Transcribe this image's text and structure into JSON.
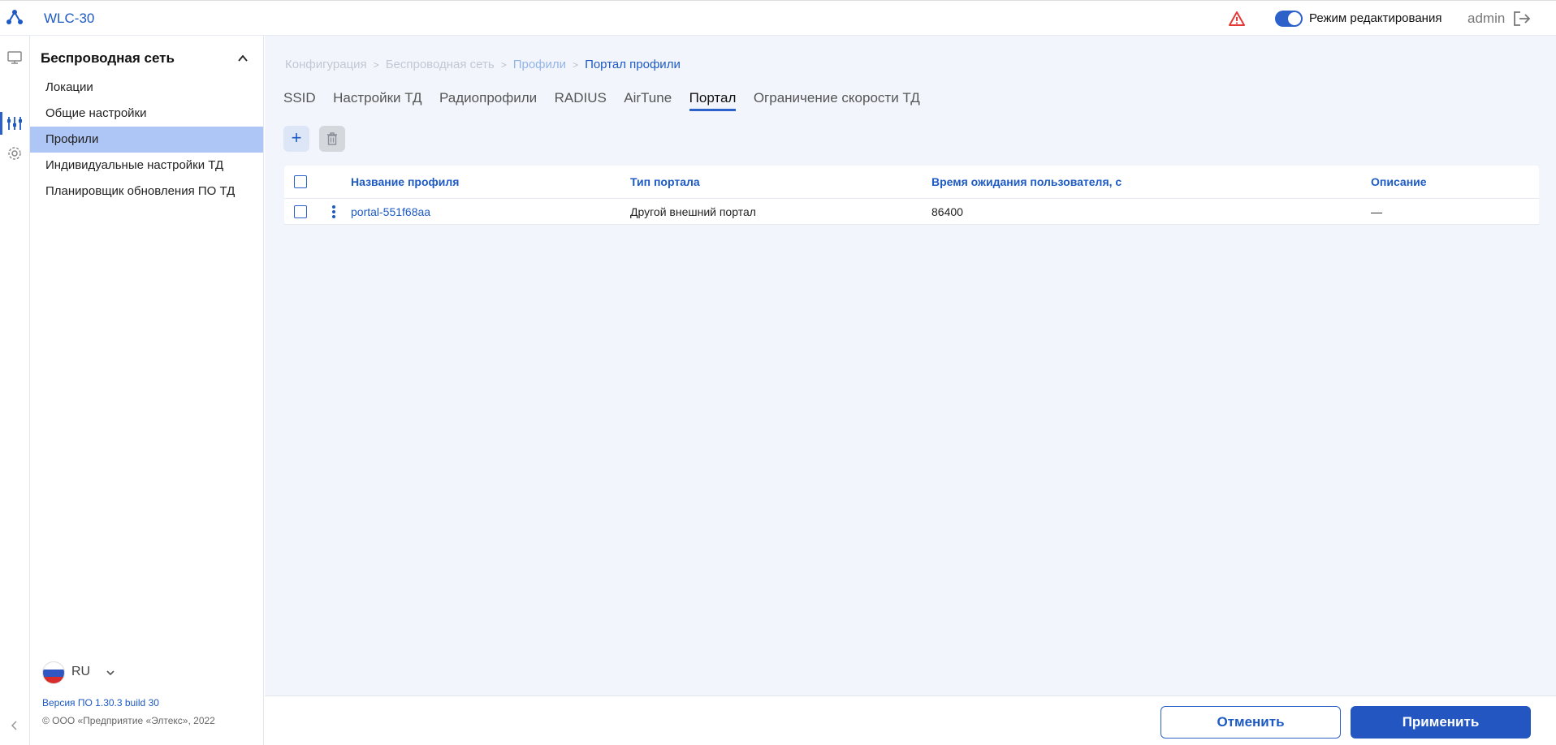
{
  "header": {
    "product": "WLC-30",
    "edit_mode_label": "Режим редактирования",
    "edit_mode_on": true,
    "user": "admin"
  },
  "rail": {
    "icons": [
      "monitor-icon",
      "sliders-icon",
      "gear-icon"
    ],
    "active_index": 1
  },
  "sidebar": {
    "section_title": "Беспроводная сеть",
    "items": [
      {
        "label": "Локации",
        "active": false
      },
      {
        "label": "Общие настройки",
        "active": false
      },
      {
        "label": "Профили",
        "active": true
      },
      {
        "label": "Индивидуальные настройки ТД",
        "active": false
      },
      {
        "label": "Планировщик обновления ПО ТД",
        "active": false
      }
    ],
    "language": "RU",
    "version": "Версия ПО 1.30.3 build 30",
    "copyright": "© ООО «Предприятие «Элтекс», 2022"
  },
  "breadcrumb": [
    "Конфигурация",
    "Беспроводная сеть",
    "Профили",
    "Портал профили"
  ],
  "tabs": [
    {
      "label": "SSID",
      "active": false
    },
    {
      "label": "Настройки ТД",
      "active": false
    },
    {
      "label": "Радиопрофили",
      "active": false
    },
    {
      "label": "RADIUS",
      "active": false
    },
    {
      "label": "AirTune",
      "active": false
    },
    {
      "label": "Портал",
      "active": true
    },
    {
      "label": "Ограничение скорости ТД",
      "active": false
    }
  ],
  "toolbar": {
    "add_label": "+"
  },
  "table": {
    "columns": [
      "Название профиля",
      "Тип портала",
      "Время ожидания пользователя, с",
      "Описание"
    ],
    "rows": [
      [
        "portal-551f68aa",
        "Другой внешний портал",
        "86400",
        "—"
      ]
    ]
  },
  "actions": {
    "cancel_label": "Отменить",
    "apply_label": "Применить"
  },
  "colors": {
    "accent": "#2356c1",
    "alert": "#e53935",
    "active_nav": "#adc6f5",
    "main_bg": "#f2f6fc"
  }
}
